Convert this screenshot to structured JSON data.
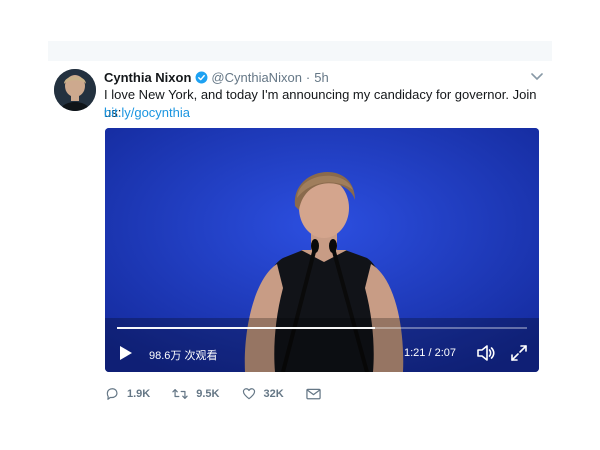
{
  "tweet": {
    "author_name": "Cynthia Nixon",
    "handle": "@CynthiaNixon",
    "separator": "·",
    "time": "5h",
    "text": "I love New York, and today I'm announcing my candidacy for governor. Join us:",
    "link": "bit.ly/gocynthia"
  },
  "video": {
    "views": "98.6万 次观看",
    "time_display": "1:21 / 2:07",
    "progress": 0.63
  },
  "actions": {
    "replies": "1.9K",
    "retweets": "9.5K",
    "likes": "32K"
  },
  "icons": {
    "verified": "verified-badge-icon",
    "caret": "chevron-down-icon",
    "play": "play-icon",
    "volume": "volume-icon",
    "fullscreen": "fullscreen-icon",
    "reply": "reply-icon",
    "retweet": "retweet-icon",
    "like": "heart-icon",
    "message": "envelope-icon"
  },
  "colors": {
    "link": "#1b95e0",
    "verified": "#1da1f2",
    "muted": "#657786",
    "video_bg": "#1a35b8"
  }
}
